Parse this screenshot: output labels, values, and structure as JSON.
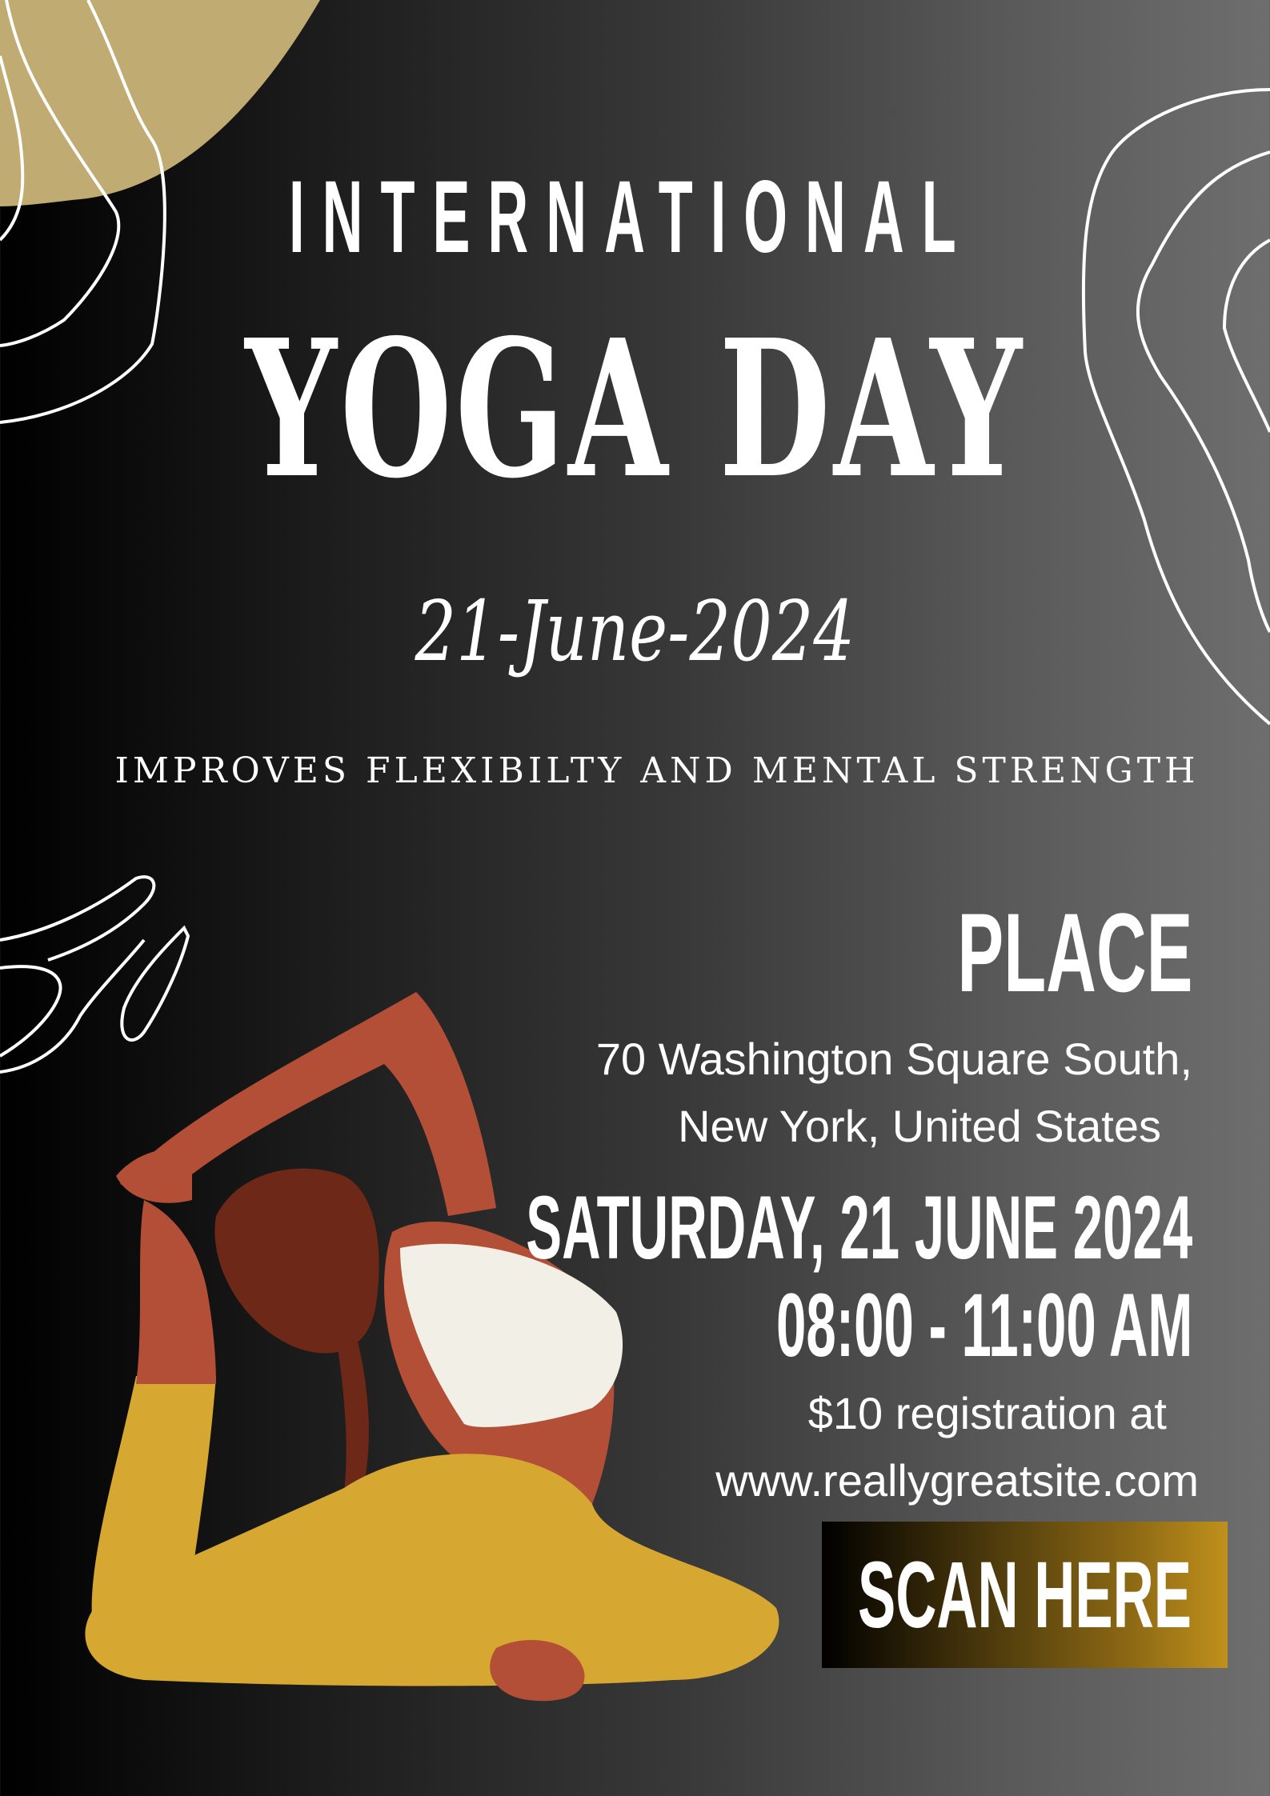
{
  "poster": {
    "heading_line1": "INTERNATIONAL",
    "heading_line2": "YOGA DAY",
    "date_script": "21-June-2024",
    "tagline": "IMPROVES FLEXIBILTY AND MENTAL STRENGTH",
    "place_label": "PLACE",
    "address_line1": "70 Washington Square South,",
    "address_line2": "New York, United States",
    "event_date": "SATURDAY, 21 JUNE 2024",
    "event_time": "08:00 - 11:00 AM",
    "registration_line1": "$10 registration at",
    "registration_line2": "www.reallygreatsite.com",
    "scan_button": "SCAN HERE"
  },
  "colors": {
    "accent_gold": "#c0ab72",
    "button_gold": "#c0901c",
    "skin": "#b34f36",
    "pants": "#d6a832",
    "top": "#f1efe6",
    "hair": "#6e2818"
  }
}
